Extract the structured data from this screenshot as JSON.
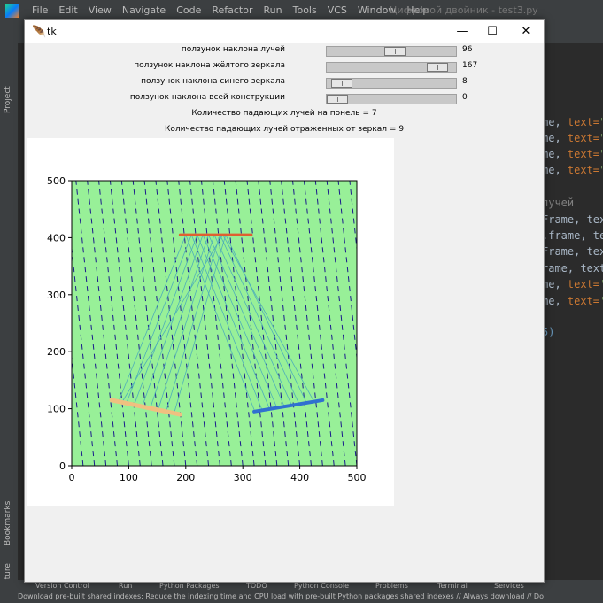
{
  "ide": {
    "menu": [
      "File",
      "Edit",
      "View",
      "Navigate",
      "Code",
      "Refactor",
      "Run",
      "Tools",
      "VCS",
      "Window",
      "Help"
    ],
    "title": "Цифровой двойник - test3.py",
    "left_tabs": [
      "Project",
      "Bookmarks",
      "Structure"
    ],
    "editor_lines": [
      {
        "pre": "me, ",
        "kw": "text=",
        "str": "\""
      },
      {
        "pre": "me, ",
        "kw": "text=",
        "str": "\""
      },
      {
        "pre": "me, ",
        "kw": "text=",
        "str": "\""
      },
      {
        "pre": "me, ",
        "kw": "text=",
        "str": "\""
      },
      {
        "pre": "",
        "kw": "",
        "str": "",
        "cmt": "лучей"
      },
      {
        "pre": "Frame, tex",
        "kw": "",
        "str": ""
      },
      {
        "pre": ".frame, te",
        "kw": "",
        "str": ""
      },
      {
        "pre": "Frame, tex",
        "kw": "",
        "str": ""
      },
      {
        "pre": "rame, text",
        "kw": "",
        "str": ""
      },
      {
        "pre": "me, ",
        "kw": "text=",
        "str": "'"
      },
      {
        "pre": "me, ",
        "kw": "text=",
        "str": "'"
      },
      {
        "pre": "",
        "kw": "",
        "str": "",
        "num": "5)"
      }
    ],
    "bottom_tabs": [
      "Version Control",
      "Run",
      "Python Packages",
      "TODO",
      "Python Console",
      "Problems",
      "Terminal",
      "Services"
    ],
    "status": "Download pre-built shared indexes: Reduce the indexing time and CPU load with pre-built Python packages shared indexes // Always download // Do"
  },
  "tk": {
    "title": "tk",
    "sliders": [
      {
        "label": "ползунок наклона лучей",
        "value": 96,
        "max": 180
      },
      {
        "label": "ползунок наклона жёлтого зеркала",
        "value": 167,
        "max": 180
      },
      {
        "label": "ползунок наклона синего зеркала",
        "value": 8,
        "max": 180
      },
      {
        "label": "ползунок наклона всей конструкции",
        "value": 0,
        "max": 180
      }
    ],
    "panel_count_text": "Количество падающих лучей на понель = 7",
    "mirror_count_text": "Количество падающих лучей отраженных от зеркал = 9"
  },
  "chart_data": {
    "type": "line",
    "xlim": [
      0,
      500
    ],
    "ylim": [
      0,
      500
    ],
    "x_ticks": [
      0,
      100,
      200,
      300,
      400,
      500
    ],
    "y_ticks": [
      0,
      100,
      200,
      300,
      400,
      500
    ],
    "background": "#98f098",
    "series": [
      {
        "segment": [
          [
            190,
            405
          ],
          [
            315,
            405
          ]
        ],
        "color": "#e06030",
        "linewidth": 3
      },
      {
        "segment": [
          [
            70,
            115
          ],
          [
            190,
            90
          ]
        ],
        "color": "#f0c080",
        "linewidth": 5
      },
      {
        "segment": [
          [
            320,
            95
          ],
          [
            440,
            115
          ]
        ],
        "color": "#3070d0",
        "linewidth": 4
      }
    ],
    "incident_rays": {
      "angle_deg": 96,
      "spacing": 20,
      "color": "#1a1a8c"
    },
    "reflected_rays": [
      {
        "points": [
          [
            82,
            112
          ],
          [
            200,
            405
          ],
          [
            320,
            98
          ]
        ]
      },
      {
        "points": [
          [
            96,
            110
          ],
          [
            210,
            405
          ],
          [
            333,
            100
          ]
        ]
      },
      {
        "points": [
          [
            110,
            108
          ],
          [
            220,
            405
          ],
          [
            346,
            102
          ]
        ]
      },
      {
        "points": [
          [
            124,
            105
          ],
          [
            230,
            405
          ],
          [
            359,
            104
          ]
        ]
      },
      {
        "points": [
          [
            138,
            102
          ],
          [
            240,
            405
          ],
          [
            372,
            106
          ]
        ]
      },
      {
        "points": [
          [
            152,
            100
          ],
          [
            250,
            405
          ],
          [
            385,
            108
          ]
        ]
      },
      {
        "points": [
          [
            166,
            97
          ],
          [
            260,
            405
          ],
          [
            398,
            110
          ]
        ]
      },
      {
        "points": [
          [
            180,
            94
          ],
          [
            270,
            405
          ],
          [
            411,
            112
          ]
        ]
      },
      {
        "points": [
          [
            88,
            111
          ],
          [
            265,
            405
          ],
          [
            424,
            114
          ]
        ]
      }
    ],
    "reflected_color": "#4fb0b8"
  }
}
